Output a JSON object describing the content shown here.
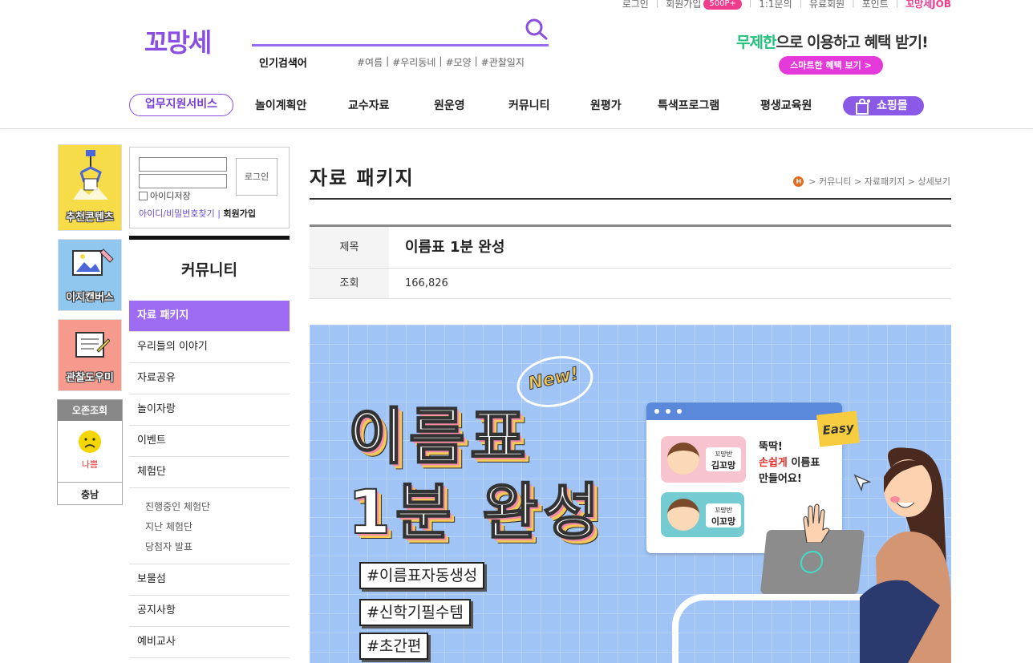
{
  "util": {
    "login": "로그인",
    "join": "회원가입",
    "join_badge": "500P+",
    "qna": "1:1문의",
    "paid": "유료회원",
    "point": "포인트",
    "job": "꼬망세JOB"
  },
  "logo": "꼬망세",
  "search": {
    "popular_label": "인기검색어",
    "tags": [
      "#여름",
      "#우리동네",
      "#모양",
      "#관찰일지"
    ]
  },
  "promo": {
    "highlight": "무제한",
    "text": "으로 이용하고 혜택 받기!",
    "button": "스마트한 혜택 보기 >"
  },
  "nav": {
    "support": "업무지원서비스",
    "items": [
      "놀이계획안",
      "교수자료",
      "원운영",
      "커뮤니티",
      "원평가",
      "특색프로그램",
      "평생교육원"
    ],
    "shop": "쇼핑몰"
  },
  "quick": {
    "recommend": "추천콘텐츠",
    "canvas": "이지캔버스",
    "observe": "관찰도우미"
  },
  "weather": {
    "header": "오존조회",
    "status": "나쁨",
    "region": "충남"
  },
  "login": {
    "button": "로그인",
    "save_id": "아이디저장",
    "find": "아이디/비밀번호찾기",
    "sep": " | ",
    "join": "회원가입"
  },
  "sidebar": {
    "title": "커뮤니티",
    "items": [
      "자료 패키지",
      "우리들의 이야기",
      "자료공유",
      "놀이자랑",
      "이벤트",
      "체험단"
    ],
    "sub": [
      "진행중인 체험단",
      "지난 체험단",
      "당첨자 발표"
    ],
    "items2": [
      "보물섬",
      "공지사항",
      "예비교사"
    ]
  },
  "page": {
    "title": "자료 패키지",
    "breadcrumb": "> 커뮤니티 > 자료패키지 > 상세보기",
    "home": "H"
  },
  "info": {
    "title_label": "제목",
    "title_value": "이름표 1분 완성",
    "views_label": "조회",
    "views_value": "166,826"
  },
  "banner": {
    "new": "New!",
    "line1": "이름표",
    "line2": "1분 완성",
    "tags": [
      "#이름표자동생성",
      "#신학기필수템",
      "#초간편"
    ],
    "easy": "Easy",
    "tag1_class": "꼬망반",
    "tag1_name": "김꼬망",
    "tag2_class": "꼬망반",
    "tag2_name": "이꼬망",
    "msg1": "뚝딱!",
    "msg2_red": "손쉽게",
    "msg2": " 이름표",
    "msg3": "만들어요!"
  }
}
